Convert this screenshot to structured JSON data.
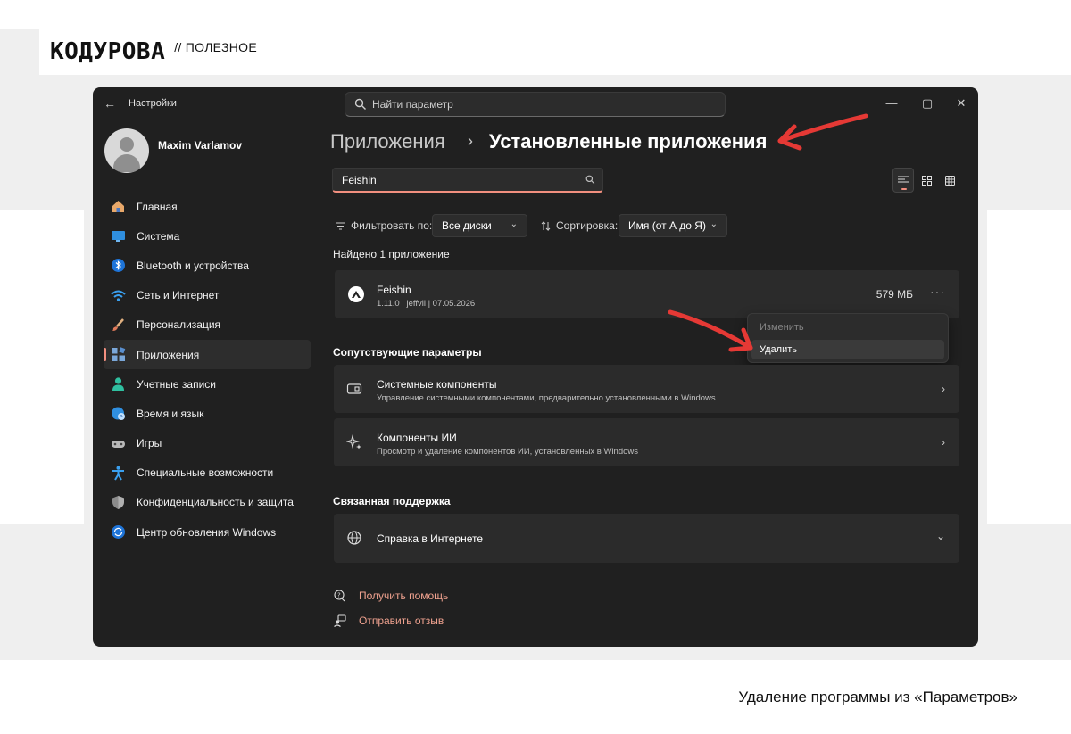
{
  "brand": {
    "logo": "KOДУРОВА",
    "tag": "// ПОЛЕЗНОЕ"
  },
  "caption": "Удаление программы из «Параметров»",
  "window": {
    "title": "Настройки",
    "search_placeholder": "Найти параметр",
    "controls": {
      "minimize": "—",
      "maximize": "▢",
      "close": "✕"
    }
  },
  "profile": {
    "name": "Maxim Varlamov"
  },
  "sidebar": {
    "items": [
      {
        "label": "Главная",
        "icon": "home-icon",
        "active": false
      },
      {
        "label": "Система",
        "icon": "display-icon",
        "active": false
      },
      {
        "label": "Bluetooth и устройства",
        "icon": "bluetooth-icon",
        "active": false
      },
      {
        "label": "Сеть и Интернет",
        "icon": "wifi-icon",
        "active": false
      },
      {
        "label": "Персонализация",
        "icon": "brush-icon",
        "active": false
      },
      {
        "label": "Приложения",
        "icon": "apps-icon",
        "active": true
      },
      {
        "label": "Учетные записи",
        "icon": "account-icon",
        "active": false
      },
      {
        "label": "Время и язык",
        "icon": "globe-clock-icon",
        "active": false
      },
      {
        "label": "Игры",
        "icon": "gamepad-icon",
        "active": false
      },
      {
        "label": "Специальные возможности",
        "icon": "accessibility-icon",
        "active": false
      },
      {
        "label": "Конфиденциальность и защита",
        "icon": "shield-icon",
        "active": false
      },
      {
        "label": "Центр обновления Windows",
        "icon": "update-icon",
        "active": false
      }
    ]
  },
  "main": {
    "breadcrumb": {
      "parent": "Приложения",
      "separator": "›",
      "current": "Установленные приложения"
    },
    "search_value": "Feishin",
    "filter": {
      "label": "Фильтровать по:",
      "value": "Все диски"
    },
    "sort": {
      "label": "Сортировка:",
      "value": "Имя (от А до Я)"
    },
    "found_text": "Найдено 1 приложение",
    "app": {
      "name": "Feishin",
      "version": "1.11.0",
      "publisher": "jeffvli",
      "date": "07.05.2026",
      "meta": "1.11.0   |   jeffvli   |   07.05.2026",
      "size": "579 МБ",
      "more": "···"
    },
    "context_menu": {
      "modify": "Изменить",
      "uninstall": "Удалить"
    },
    "related_heading": "Сопутствующие параметры",
    "related": [
      {
        "title": "Системные компоненты",
        "subtitle": "Управление системными компонентами, предварительно установленными в Windows"
      },
      {
        "title": "Компоненты ИИ",
        "subtitle": "Просмотр и удаление компонентов ИИ, установленных в Windows"
      }
    ],
    "support_heading": "Связанная поддержка",
    "support_item": "Справка в Интернете",
    "links": {
      "help": "Получить помощь",
      "feedback": "Отправить отзыв"
    }
  },
  "colors": {
    "accent": "#f28f7f",
    "window_bg": "#202020",
    "card_bg": "#2b2b2b",
    "arrow": "#e53935",
    "link": "#f0a28f"
  }
}
